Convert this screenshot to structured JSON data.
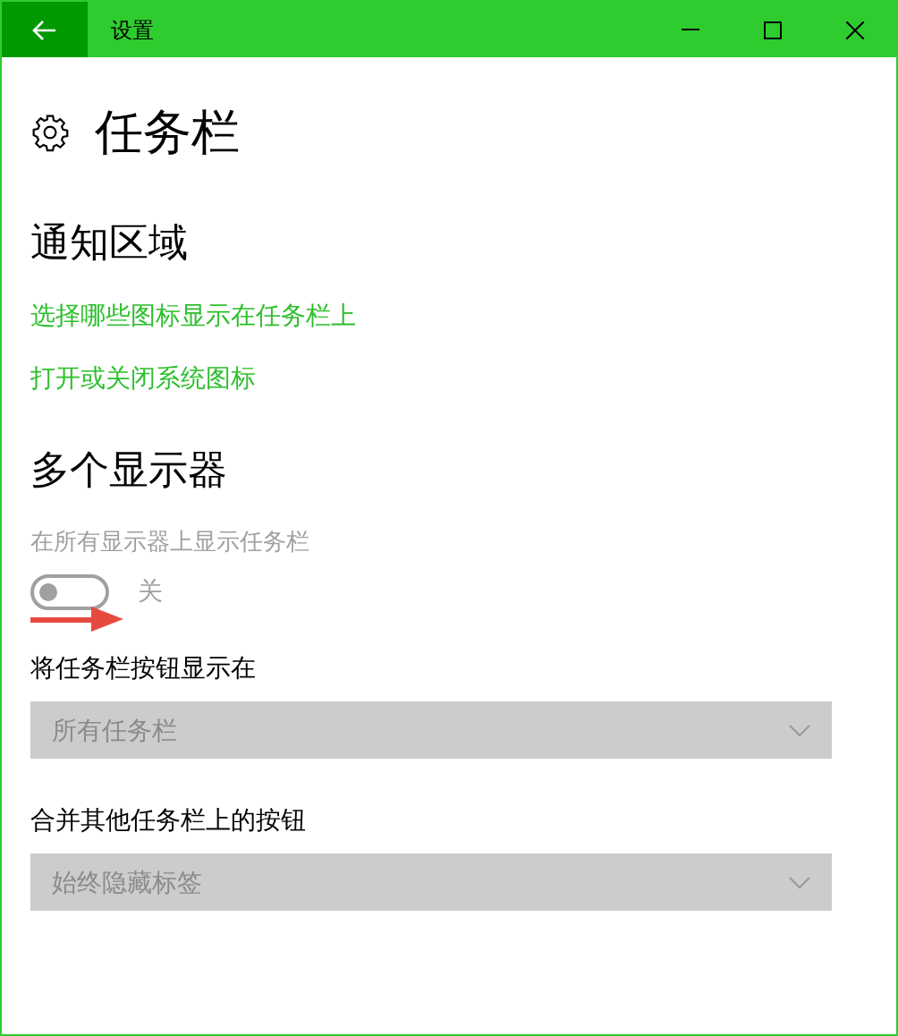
{
  "window": {
    "title": "设置"
  },
  "page": {
    "title": "任务栏"
  },
  "sections": [
    {
      "heading": "通知区域",
      "items": [
        {
          "kind": "link",
          "text": "选择哪些图标显示在任务栏上"
        },
        {
          "kind": "link",
          "text": "打开或关闭系统图标"
        }
      ]
    },
    {
      "heading": "多个显示器",
      "items": [
        {
          "kind": "toggle",
          "label": "在所有显示器上显示任务栏",
          "on": false,
          "disabled": true,
          "state_text": "关"
        },
        {
          "kind": "dropdown",
          "label": "将任务栏按钮显示在",
          "value": "所有任务栏",
          "disabled": true
        },
        {
          "kind": "dropdown",
          "label": "合并其他任务栏上的按钮",
          "value": "始终隐藏标签",
          "disabled": true
        }
      ]
    }
  ]
}
